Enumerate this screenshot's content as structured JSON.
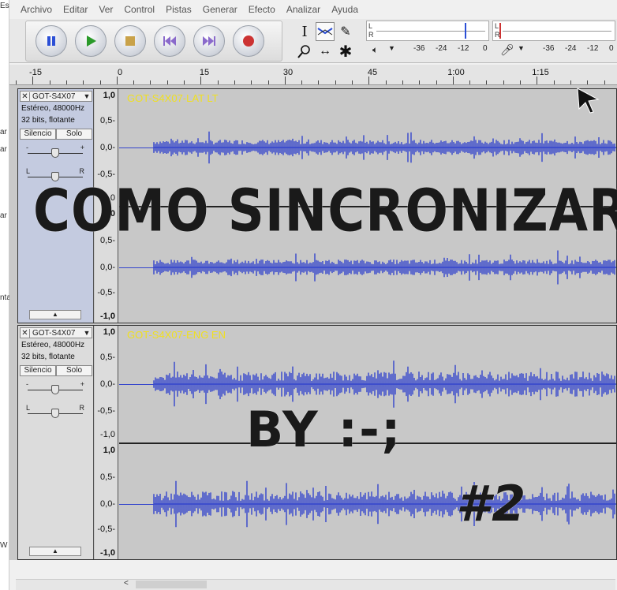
{
  "left_strip": [
    "Es",
    "ar",
    "ar",
    "ar",
    "nta",
    "W"
  ],
  "menu": [
    "Archivo",
    "Editar",
    "Ver",
    "Control",
    "Pistas",
    "Generar",
    "Efecto",
    "Analizar",
    "Ayuda"
  ],
  "meters": {
    "play": {
      "left": "L",
      "right": "R",
      "scale": [
        "-36",
        "-24",
        "-12",
        "0"
      ]
    },
    "record": {
      "left": "L",
      "right": "R",
      "scale": [
        "-36",
        "-24",
        "-12",
        "0"
      ]
    }
  },
  "ruler": {
    "labels": [
      "-15",
      "0",
      "15",
      "30",
      "45",
      "1:00",
      "1:15"
    ]
  },
  "tracks": [
    {
      "name": "GOT-S4X07",
      "clip": "GOT-S4X07-LAT LT",
      "format": "Estéreo, 48000Hz",
      "bits": "32 bits, flotante",
      "mute": "Silencio",
      "solo": "Solo",
      "gain_minus": "-",
      "gain_plus": "+",
      "pan_left": "L",
      "pan_right": "R",
      "scale": [
        "1,0",
        "0,5-",
        "0,0-",
        "-0,5-",
        "-1,0",
        "1,0",
        "0,5-",
        "0,0-",
        "-0,5-",
        "-1,0"
      ]
    },
    {
      "name": "GOT-S4X07",
      "clip": "GOT-S4X07-ENG EN",
      "format": "Estéreo, 48000Hz",
      "bits": "32 bits, flotante",
      "mute": "Silencio",
      "solo": "Solo",
      "gain_minus": "-",
      "gain_plus": "+",
      "pan_left": "L",
      "pan_right": "R",
      "scale": [
        "1,0",
        "0,5-",
        "0,0-",
        "-0,5-",
        "-1,0",
        "1,0",
        "0,5-",
        "0,0-",
        "-0,5-",
        "-1,0"
      ]
    }
  ],
  "overlay": {
    "line1": "COMO SINCRONIZAR",
    "line2": "BY :-;",
    "line3": "#2"
  },
  "icons": {
    "pause": "pause-icon",
    "play": "play-icon",
    "stop": "stop-icon",
    "skip_start": "skip-start-icon",
    "skip_end": "skip-end-icon",
    "record": "record-icon"
  },
  "colors": {
    "waveform": "#3344cc",
    "clip_name": "#f0e020",
    "record": "#cc3333",
    "play": "#2a9a2a"
  }
}
